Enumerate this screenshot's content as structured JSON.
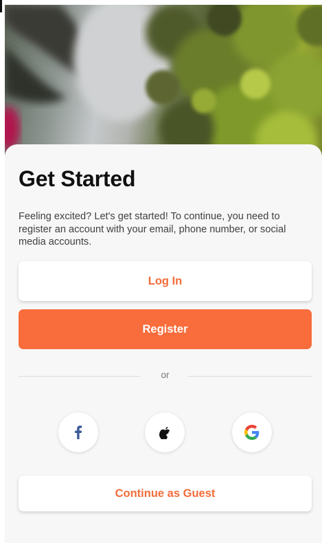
{
  "sheet": {
    "title": "Get Started",
    "subtitle": "Feeling excited? Let's get started! To continue, you need to register an account with your email, phone number, or social media accounts."
  },
  "buttons": {
    "login_label": "Log In",
    "register_label": "Register",
    "guest_label": "Continue as Guest"
  },
  "divider": {
    "text": "or"
  },
  "social": [
    {
      "name": "facebook",
      "icon": "facebook-icon"
    },
    {
      "name": "apple",
      "icon": "apple-icon"
    },
    {
      "name": "google",
      "icon": "google-icon"
    }
  ],
  "colors": {
    "accent": "#f96c3b",
    "accent_text": "#f26c3a",
    "sheet_background": "#f7f7f7",
    "facebook_blue": "#3b5998",
    "apple_black": "#111111"
  }
}
